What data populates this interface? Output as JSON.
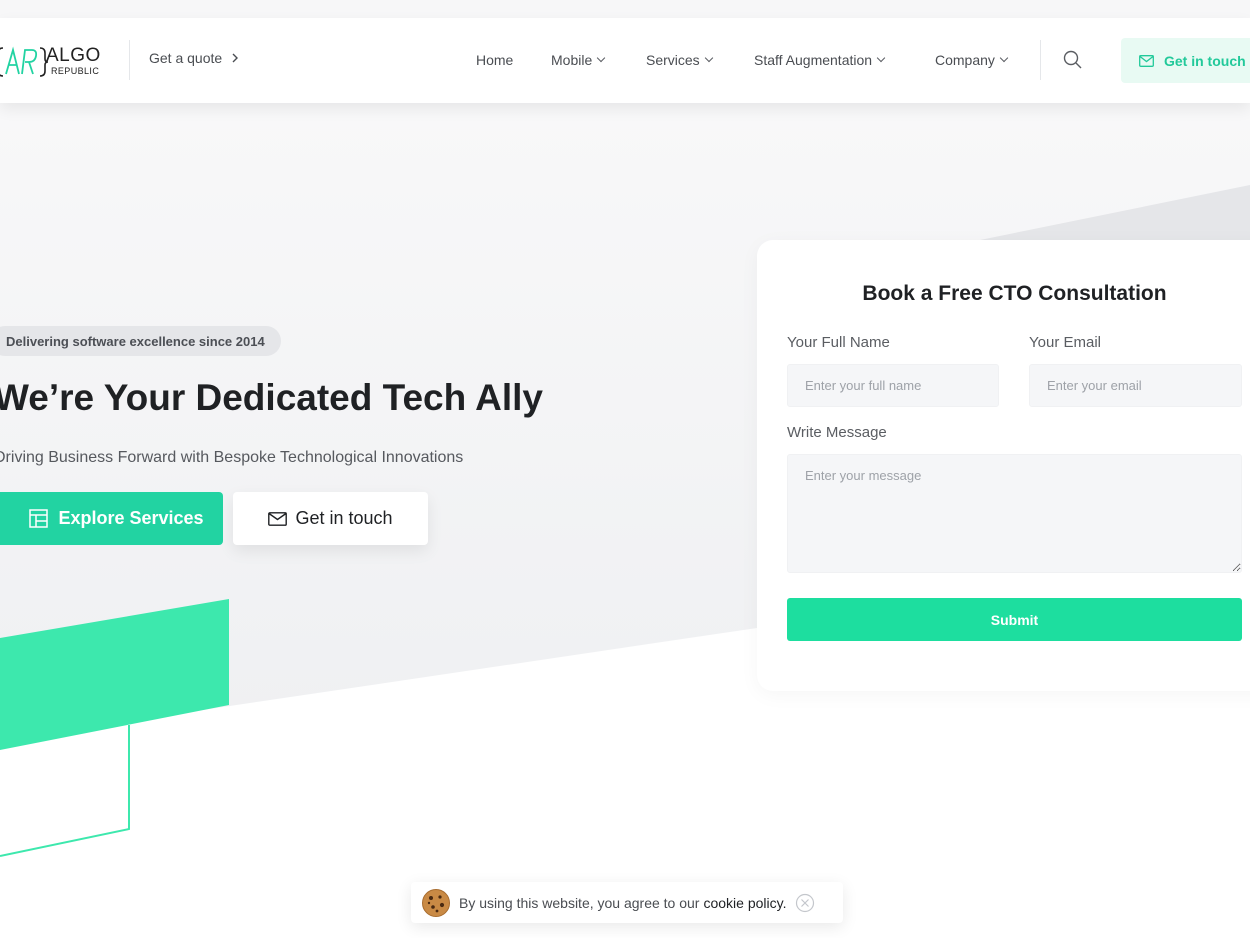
{
  "header": {
    "logo": {
      "mark": "{AR}",
      "name": "ALGO",
      "subname": "REPUBLIC"
    },
    "quote_label": "Get a quote",
    "nav": [
      {
        "label": "Home",
        "has_dropdown": false
      },
      {
        "label": "Mobile",
        "has_dropdown": true
      },
      {
        "label": "Services",
        "has_dropdown": true
      },
      {
        "label": "Staff Augmentation",
        "has_dropdown": true
      },
      {
        "label": "Company",
        "has_dropdown": true
      }
    ],
    "search_icon": "search-icon",
    "cta_label": "Get in touch",
    "cta_icon": "envelope-icon"
  },
  "hero": {
    "badge": "Delivering software excellence since 2014",
    "title": "We’re Your Dedicated Tech Ally",
    "subtitle": "Driving Business Forward with Bespoke Technological Innovations",
    "primary_button": "Explore Services",
    "primary_icon": "layout-icon",
    "secondary_button": "Get in touch",
    "secondary_icon": "envelope-icon"
  },
  "form": {
    "title": "Book a Free CTO Consultation",
    "name_label": "Your Full Name",
    "name_placeholder": "Enter your full name",
    "name_value": "",
    "email_label": "Your Email",
    "email_placeholder": "Enter your email",
    "email_value": "",
    "message_label": "Write Message",
    "message_placeholder": "Enter your message",
    "message_value": "",
    "submit_label": "Submit"
  },
  "cookie": {
    "text": "By using this website, you agree to our",
    "link": "cookie policy.",
    "icon": "cookie-icon",
    "close_icon": "close-icon"
  },
  "colors": {
    "accent": "#22d3a2",
    "accent_light": "#e8faf3",
    "submit": "#1dde9f",
    "text_dark": "#1f2124",
    "hero_bg": "#f3f4f6"
  }
}
